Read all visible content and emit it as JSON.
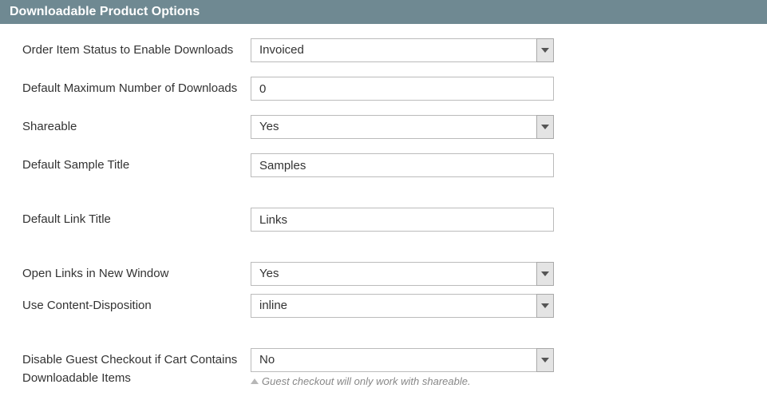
{
  "section": {
    "title": "Downloadable Product Options"
  },
  "fields": {
    "order_status": {
      "label": "Order Item Status to Enable Downloads",
      "value": "Invoiced"
    },
    "max_downloads": {
      "label": "Default Maximum Number of Downloads",
      "value": "0"
    },
    "shareable": {
      "label": "Shareable",
      "value": "Yes"
    },
    "sample_title": {
      "label": "Default Sample Title",
      "value": "Samples"
    },
    "link_title": {
      "label": "Default Link Title",
      "value": "Links"
    },
    "open_new_window": {
      "label": "Open Links in New Window",
      "value": "Yes"
    },
    "content_disposition": {
      "label": "Use Content-Disposition",
      "value": "inline"
    },
    "disable_guest": {
      "label": "Disable Guest Checkout if Cart Contains Downloadable Items",
      "value": "No",
      "hint": "Guest checkout will only work with shareable."
    }
  }
}
